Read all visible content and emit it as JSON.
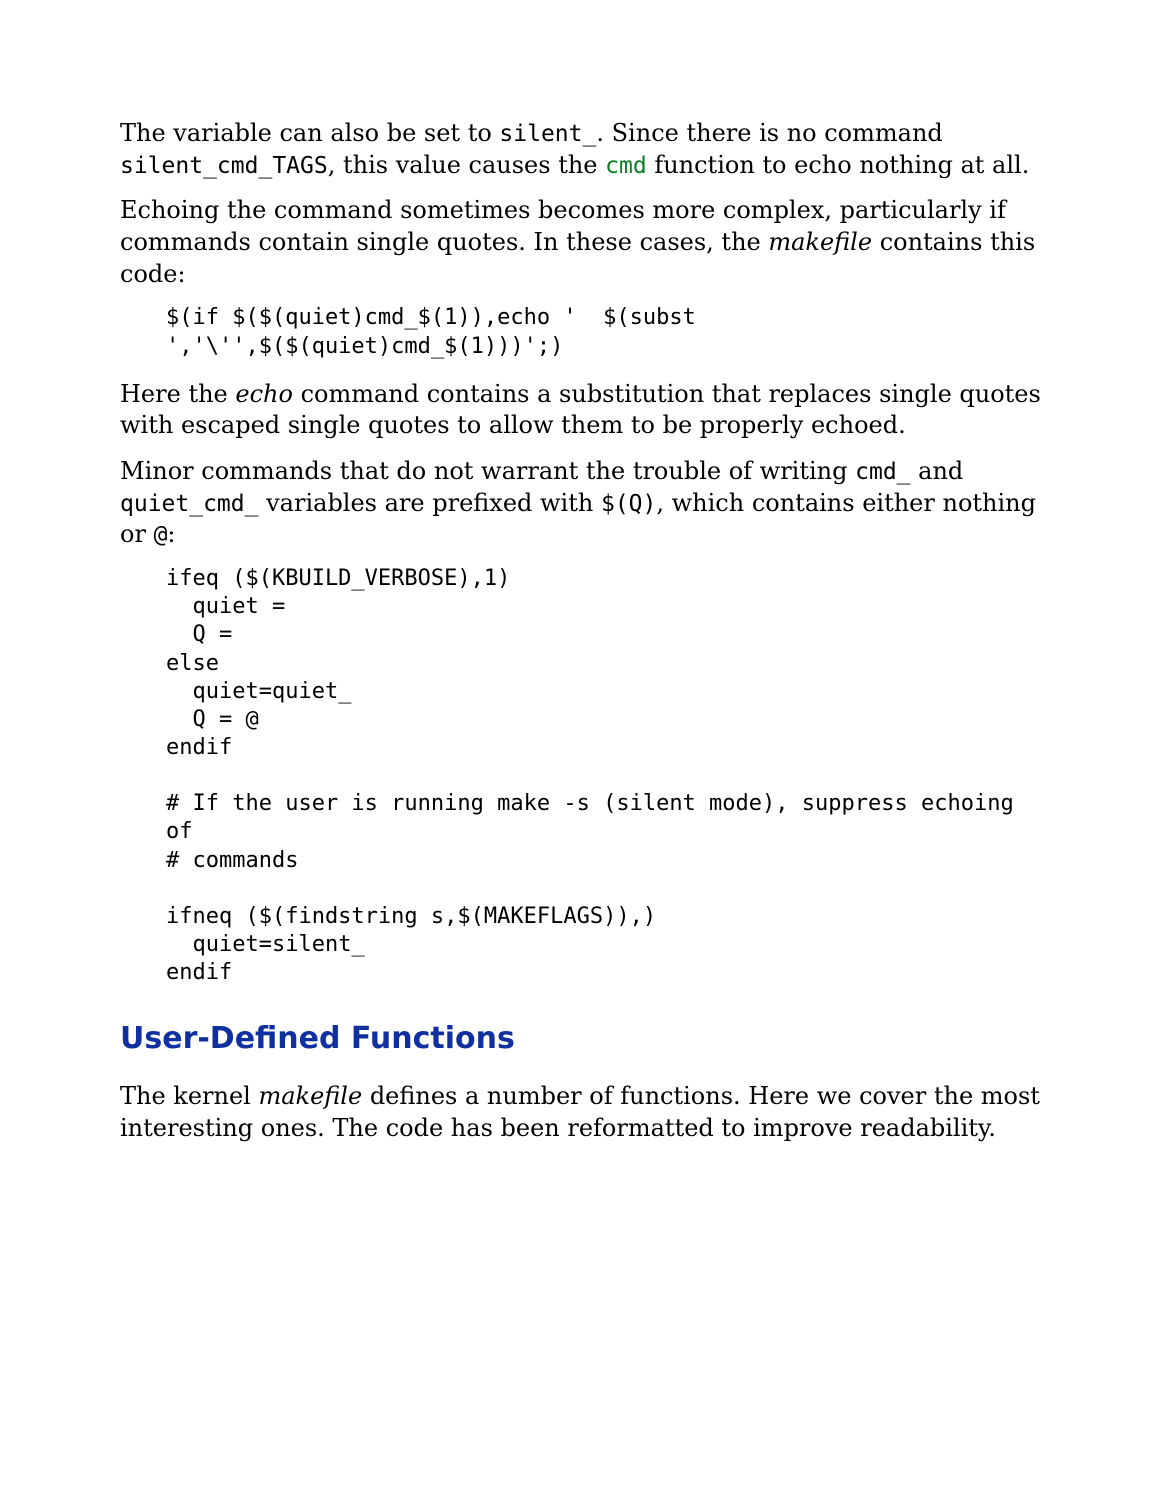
{
  "para1": {
    "t1": "The variable can also be set to ",
    "c1": "silent_",
    "t2": ". Since there is no command ",
    "c2": "silent_cmd_TAGS",
    "t3": ", this value causes the ",
    "kw": "cmd",
    "t4": " function to echo nothing at all."
  },
  "para2": {
    "t1": "Echoing the command sometimes becomes more complex, particularly if commands contain single quotes. In these cases, the ",
    "i1": "makefile",
    "t2": " contains this code:"
  },
  "code1": "$(if $($(quiet)cmd_$(1)),echo '  $(subst ','\\'',$($(quiet)cmd_$(1)))';)",
  "para3": {
    "t1": "Here the ",
    "i1": "echo",
    "t2": " command contains a substitution that replaces single quotes with escaped single quotes to allow them to be properly echoed."
  },
  "para4": {
    "t1": "Minor commands that do not warrant the trouble of writing ",
    "c1": "cmd_",
    "t2": " and ",
    "c2": "quiet_cmd_",
    "t3": " variables are prefixed with ",
    "c3": "$(Q)",
    "t4": ", which contains either nothing or ",
    "c4": "@",
    "t5": ":"
  },
  "code2": "ifeq ($(KBUILD_VERBOSE),1)\n  quiet =\n  Q =\nelse\n  quiet=quiet_\n  Q = @\nendif\n\n# If the user is running make -s (silent mode), suppress echoing of\n# commands\n\nifneq ($(findstring s,$(MAKEFLAGS)),)\n  quiet=silent_\nendif",
  "heading": "User-Defined Functions",
  "para5": {
    "t1": "The kernel ",
    "i1": "makefile",
    "t2": " defines a number of functions. Here we cover the most interesting ones. The code has been reformatted to improve readability."
  }
}
